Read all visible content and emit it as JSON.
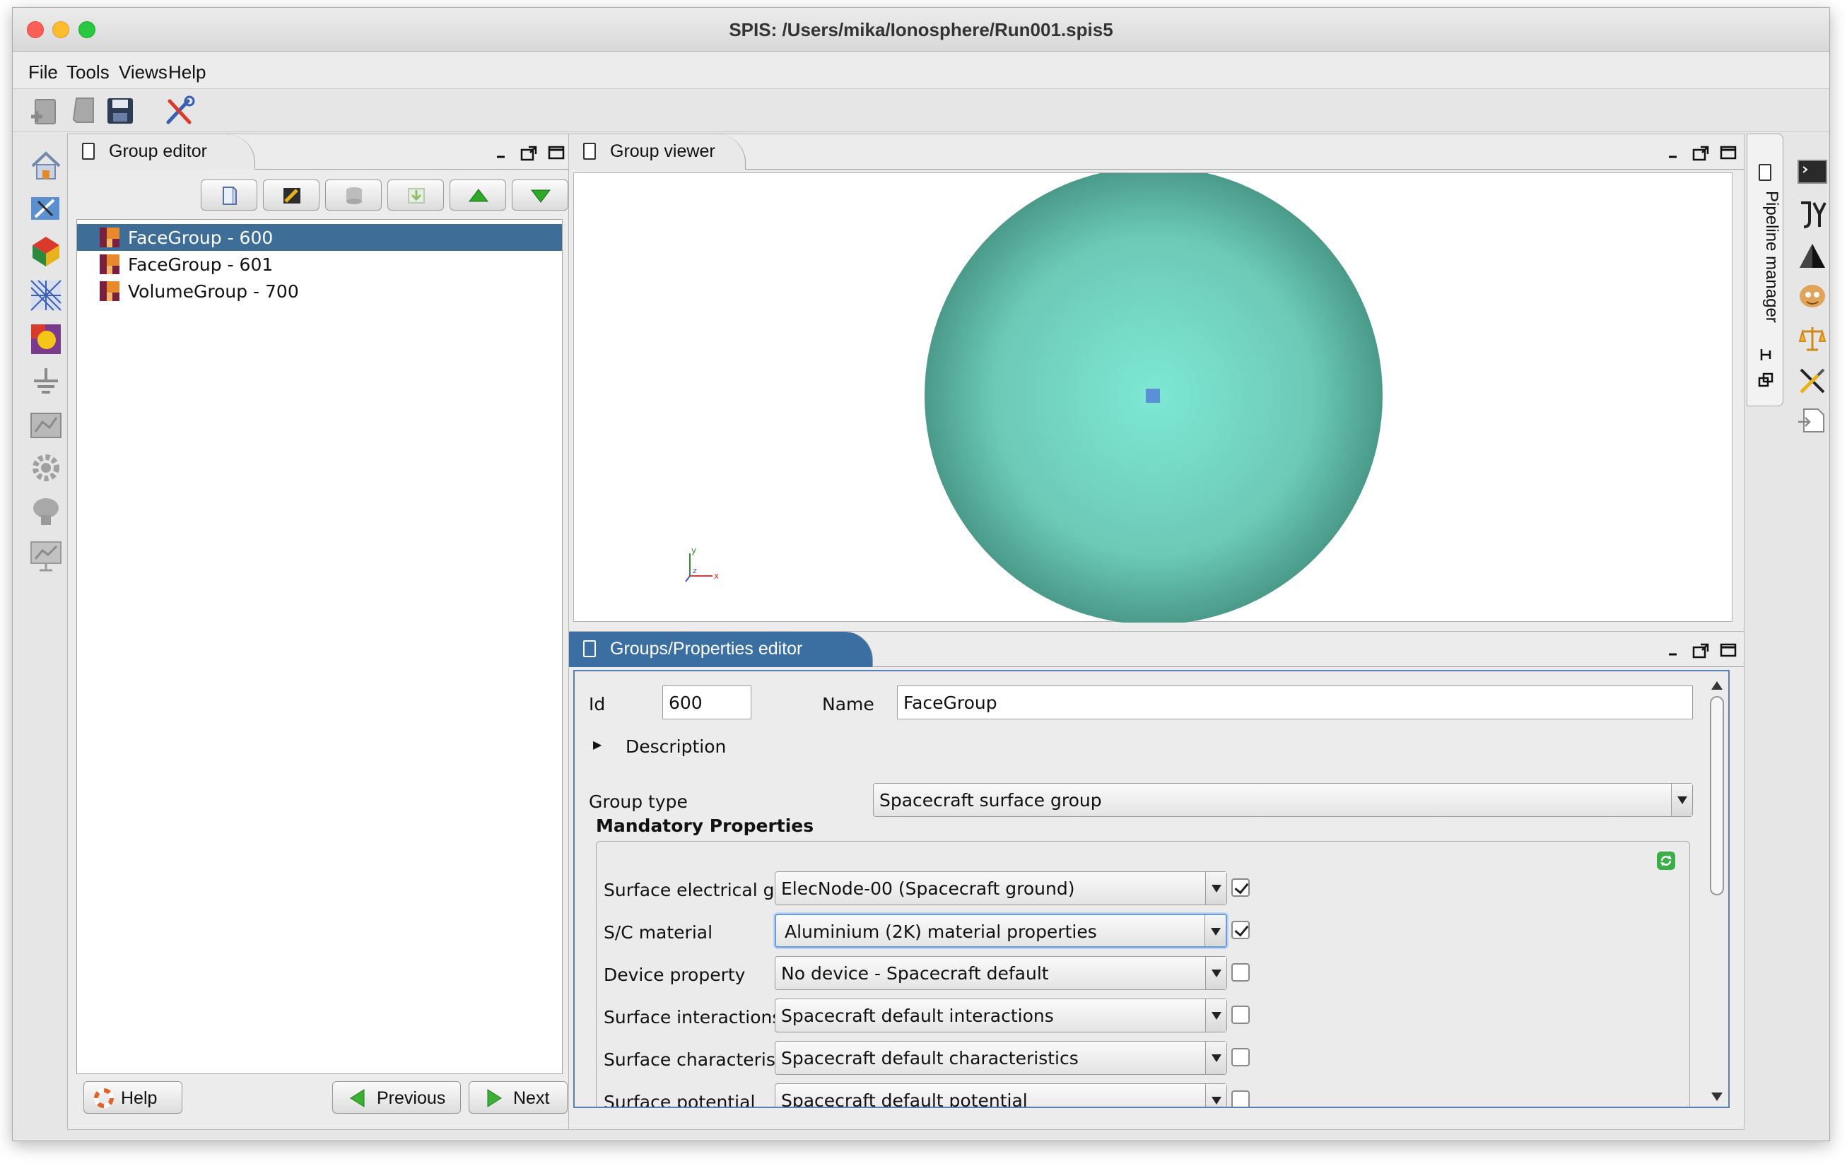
{
  "window": {
    "title": "SPIS: /Users/mika/Ionosphere/Run001.spis5"
  },
  "menu": [
    "File",
    "Tools",
    "Views",
    "Help"
  ],
  "toolbar_icons": [
    "new-project-icon",
    "open-project-icon",
    "save-icon",
    "tools-icon"
  ],
  "left_strip_icons": [
    "home-icon",
    "geometry-icon",
    "groups-icon",
    "mesh-icon",
    "materials-icon",
    "ground-icon",
    "field-icon",
    "settings-icon",
    "simulation-icon",
    "results-icon"
  ],
  "group_editor": {
    "tab_label": "Group editor",
    "toolbar_icons": [
      "new-group-icon",
      "edit-group-icon",
      "database-icon",
      "import-icon",
      "move-up-icon",
      "move-down-icon"
    ],
    "groups": [
      {
        "label": "FaceGroup - 600",
        "selected": true
      },
      {
        "label": "FaceGroup - 601",
        "selected": false
      },
      {
        "label": "VolumeGroup - 700",
        "selected": false
      }
    ],
    "help_label": "Help",
    "previous_label": "Previous",
    "next_label": "Next"
  },
  "group_viewer": {
    "tab_label": "Group viewer",
    "axis_labels": {
      "x": "x",
      "y": "y",
      "z": "z"
    },
    "colors": {
      "sphere_center": "#7de8d4",
      "sphere_edge": "#4a9a8a",
      "marker": "#5b8fd6"
    }
  },
  "properties_editor": {
    "tab_label": "Groups/Properties editor",
    "id_label": "Id",
    "id_value": "600",
    "name_label": "Name",
    "name_value": "FaceGroup",
    "description_label": "Description",
    "group_type_label": "Group type",
    "group_type_value": "Spacecraft surface group",
    "mandatory_title": "Mandatory Properties",
    "properties": [
      {
        "label": "Surface electrical ground node",
        "value": "ElecNode-00 (Spacecraft ground)",
        "checked": true
      },
      {
        "label": "S/C material",
        "value": "Aluminium (2K) material properties",
        "checked": true
      },
      {
        "label": "Device property",
        "value": "No device - Spacecraft default",
        "checked": false
      },
      {
        "label": "Surface interactions",
        "value": "Spacecraft default interactions",
        "checked": false
      },
      {
        "label": "Surface characteristics",
        "value": "Spacecraft default characteristics",
        "checked": false
      },
      {
        "label": "Surface potential",
        "value": "Spacecraft default potential",
        "checked": false
      }
    ]
  },
  "pipeline_manager": {
    "label": "Pipeline manager"
  },
  "right_strip_icons": [
    "console-icon",
    "jython-icon",
    "triangle-icon",
    "user-icon",
    "balance-icon",
    "tools-cross-icon",
    "export-icon"
  ]
}
